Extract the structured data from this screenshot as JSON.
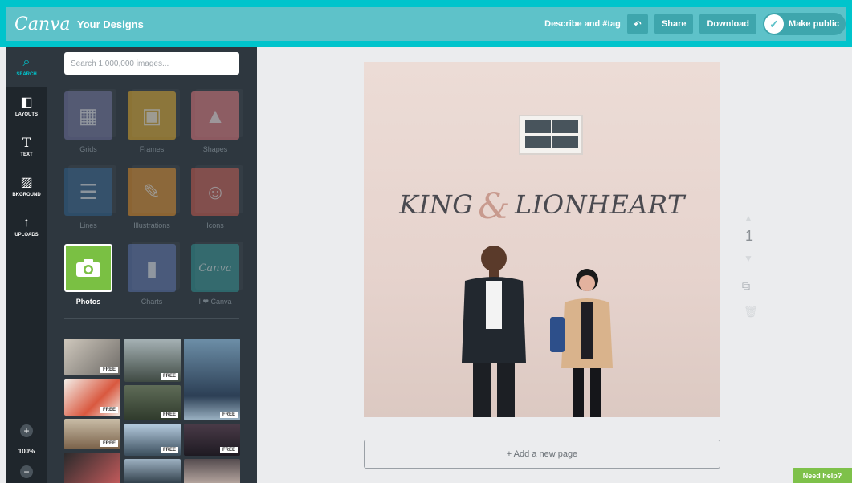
{
  "topbar": {
    "logo": "Canva",
    "your_designs": "Your Designs",
    "describe": "Describe and #tag",
    "undo_icon": "undo-icon",
    "share": "Share",
    "download": "Download",
    "make_public": "Make public"
  },
  "rail": {
    "items": [
      {
        "label": "SEARCH",
        "icon": "search-icon"
      },
      {
        "label": "LAYOUTS",
        "icon": "layouts-icon"
      },
      {
        "label": "TEXT",
        "icon": "text-icon"
      },
      {
        "label": "BKGROUND",
        "icon": "background-icon"
      },
      {
        "label": "UPLOADS",
        "icon": "upload-icon"
      }
    ],
    "zoom": "100%",
    "zoom_in": "+",
    "zoom_out": "−"
  },
  "panel": {
    "search_placeholder": "Search 1,000,000 images...",
    "categories": [
      {
        "label": "Grids",
        "color": "#6c6f9a",
        "glyph": "▦"
      },
      {
        "label": "Frames",
        "color": "#d7a52d",
        "glyph": "▣"
      },
      {
        "label": "Shapes",
        "color": "#d9757b",
        "glyph": "▲"
      },
      {
        "label": "Lines",
        "color": "#2f5f8a",
        "glyph": "☰"
      },
      {
        "label": "Illustrations",
        "color": "#d78a2a",
        "glyph": "✎"
      },
      {
        "label": "Icons",
        "color": "#c45a4f",
        "glyph": "☺"
      },
      {
        "label": "Photos",
        "color": "#7ac043",
        "glyph": "📷"
      },
      {
        "label": "Charts",
        "color": "#5870a8",
        "glyph": "▮"
      },
      {
        "label": "I ❤ Canva",
        "color": "#2e8f8f",
        "glyph": "Canva"
      }
    ],
    "free_label": "FREE"
  },
  "canvas": {
    "headline_left": "KING",
    "headline_amp": "&",
    "headline_right": "LIONHEART"
  },
  "page_controls": {
    "page_number": "1",
    "add_page": "+ Add a new page"
  },
  "need_help": "Need help?"
}
